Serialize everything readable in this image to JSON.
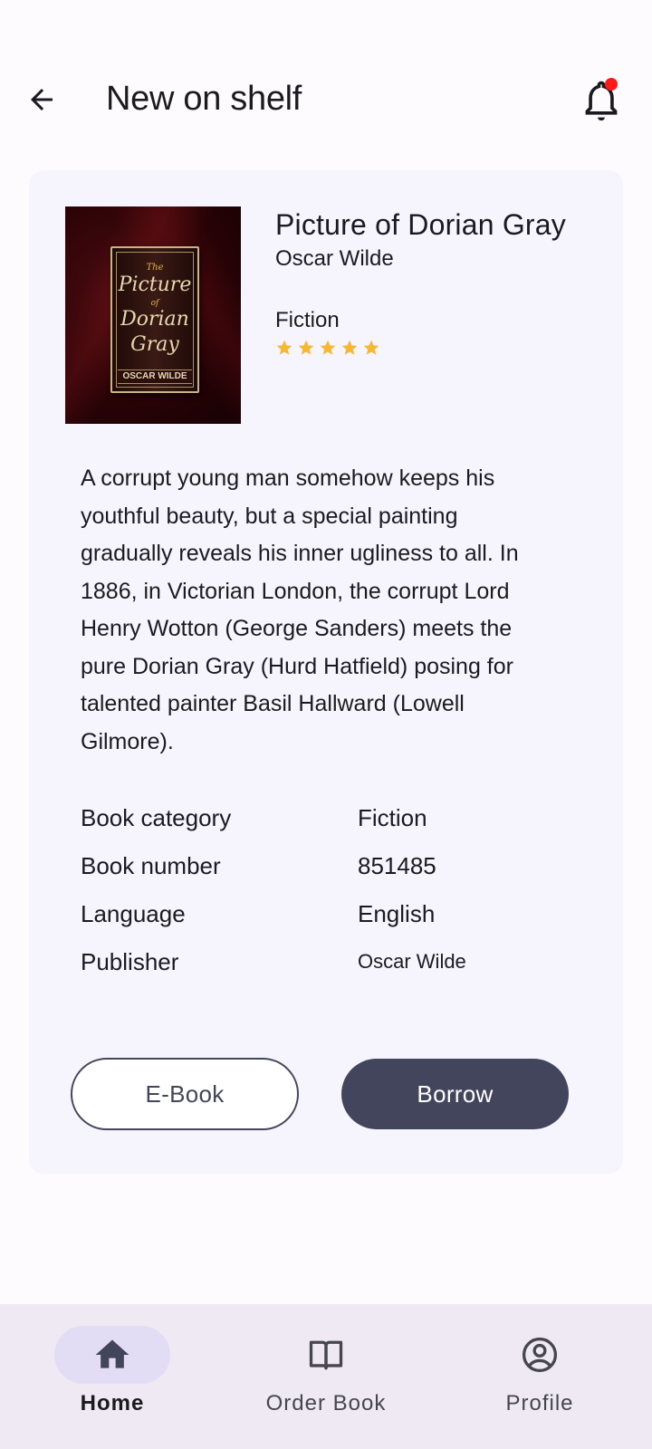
{
  "header": {
    "title": "New on shelf"
  },
  "book": {
    "title": "Picture of Dorian Gray",
    "author": "Oscar Wilde",
    "genre": "Fiction",
    "rating": 5,
    "cover": {
      "line1": "The",
      "line2": "Picture",
      "line3": "of",
      "line4": "Dorian",
      "line5": "Gray",
      "author": "OSCAR WILDE"
    },
    "description": "A corrupt young man somehow keeps his youthful beauty, but a special painting gradually reveals his inner ugliness to all. In 1886, in Victorian London, the corrupt Lord Henry Wotton (George Sanders) meets the pure Dorian Gray (Hurd Hatfield) posing for talented painter Basil Hallward (Lowell Gilmore).",
    "details": [
      {
        "label": "Book category",
        "value": "Fiction"
      },
      {
        "label": "Book number",
        "value": "851485"
      },
      {
        "label": "Language",
        "value": "English"
      },
      {
        "label": "Publisher",
        "value": "Oscar Wilde"
      }
    ]
  },
  "actions": {
    "ebook_label": "E-Book",
    "borrow_label": "Borrow"
  },
  "nav": {
    "items": [
      {
        "label": "Home",
        "icon": "home-icon",
        "active": true
      },
      {
        "label": "Order Book",
        "icon": "book-open-icon",
        "active": false
      },
      {
        "label": "Profile",
        "icon": "account-circle-icon",
        "active": false
      }
    ]
  },
  "colors": {
    "primary": "#42455c",
    "star": "#f7b731",
    "notification_dot": "#ff1a1a",
    "nav_background": "#efe9f4",
    "active_pill": "#e2dcf5"
  }
}
